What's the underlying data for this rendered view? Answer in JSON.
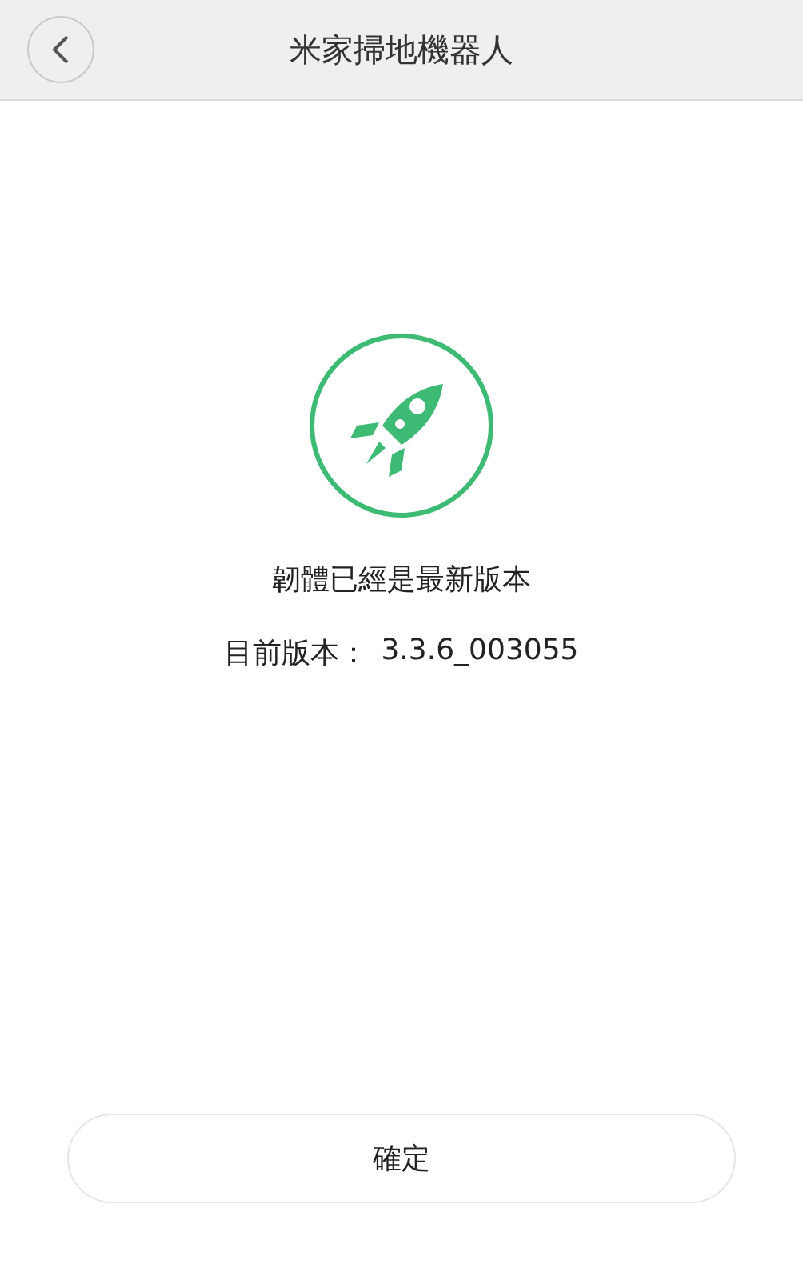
{
  "header": {
    "title": "米家掃地機器人"
  },
  "status": {
    "message": "韌體已經是最新版本",
    "version_label": "目前版本：",
    "version": "3.3.6_003055"
  },
  "buttons": [
    "確定"
  ]
}
